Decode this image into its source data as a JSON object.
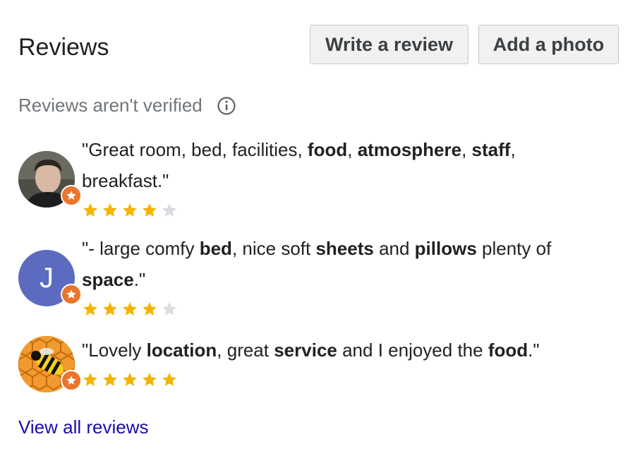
{
  "header": {
    "title": "Reviews",
    "write_review_label": "Write a review",
    "add_photo_label": "Add a photo"
  },
  "notice": {
    "text": "Reviews aren't verified",
    "icon": "info-icon"
  },
  "reviews": [
    {
      "avatar": "person-photo",
      "segments": [
        {
          "t": "\"Great room, bed, facilities, ",
          "b": false
        },
        {
          "t": "food",
          "b": true
        },
        {
          "t": ", ",
          "b": false
        },
        {
          "t": "atmosphere",
          "b": true
        },
        {
          "t": ", ",
          "b": false
        },
        {
          "t": "staff",
          "b": true
        },
        {
          "t": ", breakfast.\"",
          "b": false
        }
      ],
      "rating": 4,
      "max_rating": 5
    },
    {
      "avatar": "letter",
      "avatar_letter": "J",
      "avatar_color": "#5c6bc0",
      "segments": [
        {
          "t": "\"- large comfy ",
          "b": false
        },
        {
          "t": "bed",
          "b": true
        },
        {
          "t": ", nice soft ",
          "b": false
        },
        {
          "t": "sheets",
          "b": true
        },
        {
          "t": " and ",
          "b": false
        },
        {
          "t": "pillows",
          "b": true
        },
        {
          "t": " plenty of ",
          "b": false
        },
        {
          "t": "space",
          "b": true
        },
        {
          "t": ".\"",
          "b": false
        }
      ],
      "rating": 4,
      "max_rating": 5
    },
    {
      "avatar": "bee-illustration",
      "segments": [
        {
          "t": "\"Lovely ",
          "b": false
        },
        {
          "t": "location",
          "b": true
        },
        {
          "t": ", great ",
          "b": false
        },
        {
          "t": "service",
          "b": true
        },
        {
          "t": " and I enjoyed the ",
          "b": false
        },
        {
          "t": "food",
          "b": true
        },
        {
          "t": ".\"",
          "b": false
        }
      ],
      "rating": 5,
      "max_rating": 5
    }
  ],
  "footer": {
    "view_all_label": "View all reviews"
  },
  "colors": {
    "star_filled": "#f4b400",
    "star_empty": "#dadce0",
    "link": "#1a0dab",
    "badge": "#e8762c"
  }
}
